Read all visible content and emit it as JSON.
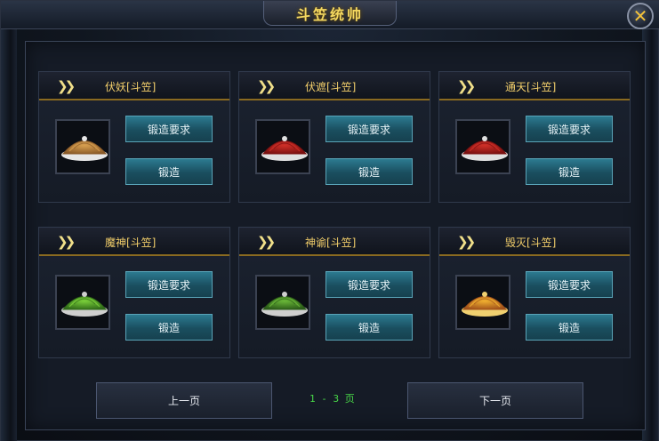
{
  "window": {
    "title": "斗笠统帅"
  },
  "cards": [
    {
      "name": "伏妖[斗笠]",
      "hat": {
        "top": "#d8a050",
        "bottom": "#8a5a28",
        "rim": "#e7e7e7",
        "icon": "beige-hat-icon"
      },
      "require_label": "锻造要求",
      "forge_label": "锻造"
    },
    {
      "name": "伏遮[斗笠]",
      "hat": {
        "top": "#d03028",
        "bottom": "#7a1010",
        "rim": "#e0e0e0",
        "icon": "red-hat-icon"
      },
      "require_label": "锻造要求",
      "forge_label": "锻造"
    },
    {
      "name": "通天[斗笠]",
      "hat": {
        "top": "#d03028",
        "bottom": "#7a1010",
        "rim": "#e0e0e0",
        "icon": "red-hat-icon"
      },
      "require_label": "锻造要求",
      "forge_label": "锻造"
    },
    {
      "name": "魔神[斗笠]",
      "hat": {
        "top": "#7ad03a",
        "bottom": "#2f6a18",
        "rim": "#cfcfcf",
        "icon": "green-hat-icon"
      },
      "require_label": "锻造要求",
      "forge_label": "锻造"
    },
    {
      "name": "神谕[斗笠]",
      "hat": {
        "top": "#6ab838",
        "bottom": "#2a5a18",
        "rim": "#cfcfcf",
        "icon": "green-hat-icon"
      },
      "require_label": "锻造要求",
      "forge_label": "锻造"
    },
    {
      "name": "毁灭[斗笠]",
      "hat": {
        "top": "#f0b030",
        "bottom": "#a0501a",
        "rim": "#f0d070",
        "icon": "gold-hat-icon"
      },
      "require_label": "锻造要求",
      "forge_label": "锻造"
    }
  ],
  "pager": {
    "prev_label": "上一页",
    "next_label": "下一页",
    "page_text": "1 - 3 页"
  }
}
